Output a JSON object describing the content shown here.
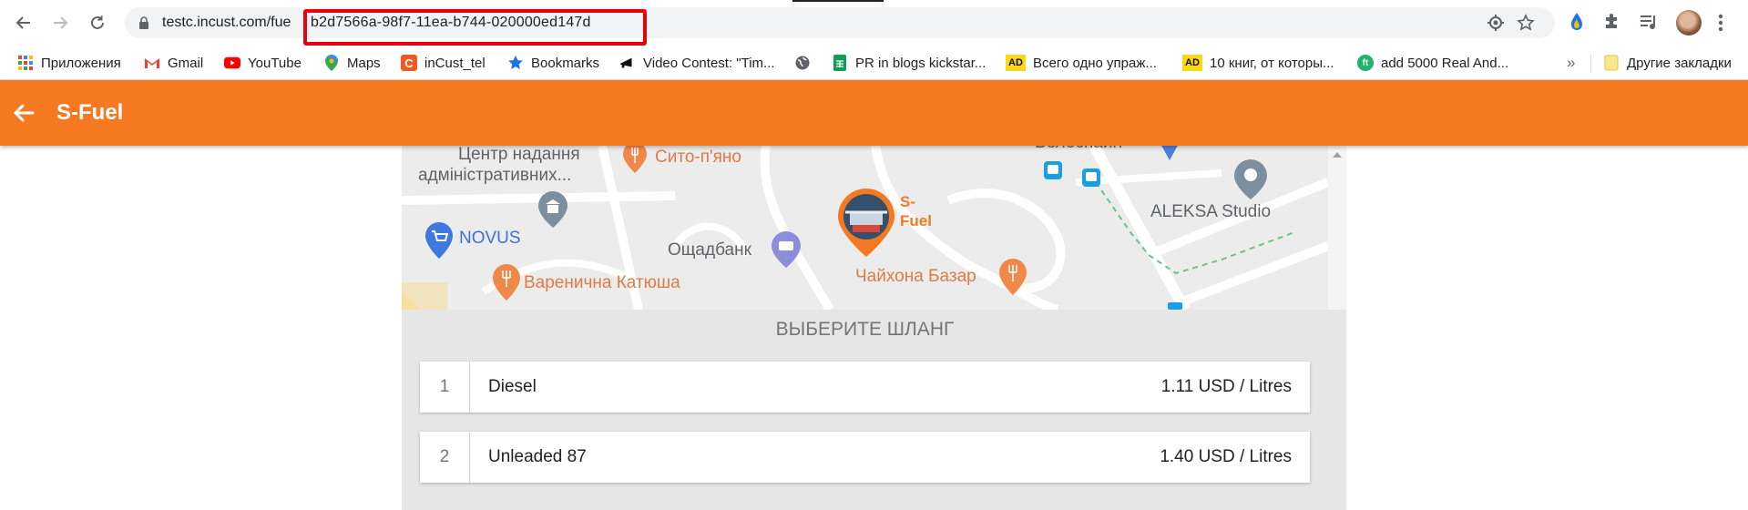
{
  "browser": {
    "url_prefix": "testc.incust.com/fue",
    "url_id": "b2d7566a-98f7-11ea-b744-020000ed147d",
    "bookmarks": [
      {
        "label": "Приложения",
        "icon": "apps-grid-icon"
      },
      {
        "label": "Gmail",
        "icon": "gmail-icon"
      },
      {
        "label": "YouTube",
        "icon": "youtube-icon"
      },
      {
        "label": "Maps",
        "icon": "maps-pin-icon"
      },
      {
        "label": "inCust_tel",
        "icon": "incust-icon"
      },
      {
        "label": "Bookmarks",
        "icon": "star-icon"
      },
      {
        "label": "Video Contest: \"Tim...",
        "icon": "megaphone-icon"
      },
      {
        "label": "",
        "icon": "globe-icon"
      },
      {
        "label": "PR in blogs kickstar...",
        "icon": "sheets-icon"
      },
      {
        "label": "Всего одно упраж...",
        "icon": "ad-icon",
        "badge": "AD"
      },
      {
        "label": "10 книг, от которы...",
        "icon": "ad-icon",
        "badge": "AD"
      },
      {
        "label": "add 5000 Real And...",
        "icon": "ft-icon",
        "badge": "ft"
      }
    ],
    "more_label": "»",
    "other_bookmarks_label": "Другие закладки"
  },
  "app": {
    "title": "S-Fuel",
    "accent": "#f47920"
  },
  "map": {
    "labels": {
      "center_admin_1": "Центр надання",
      "center_admin_2": "адміністративних...",
      "sito_piano": "Сито-п'яно",
      "velosplain": "Велоспайн",
      "aleksa": "ALEKSA Studio",
      "novus": "NOVUS",
      "oschadbank": "Ощадбанк",
      "varenychna": "Варенична Катюша",
      "chaikhona": "Чайхона Базар",
      "marker_1": "S-",
      "marker_2": "Fuel"
    }
  },
  "section_title": "ВЫБЕРИТЕ ШЛАНГ",
  "hoses": [
    {
      "number": "1",
      "name": "Diesel",
      "price": "1.11 USD / Litres"
    },
    {
      "number": "2",
      "name": "Unleaded 87",
      "price": "1.40 USD / Litres"
    }
  ]
}
